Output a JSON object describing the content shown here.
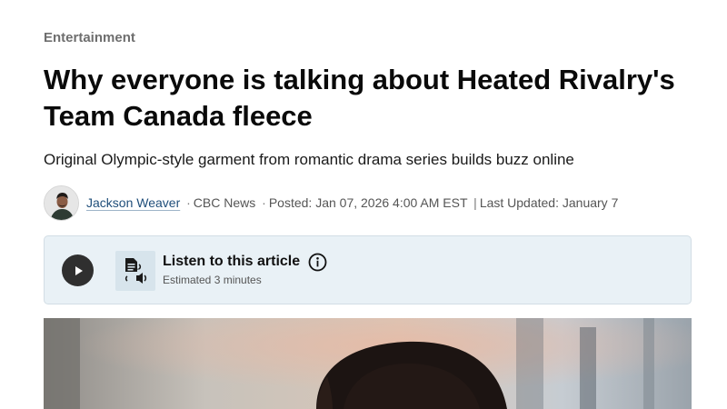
{
  "article": {
    "category": "Entertainment",
    "headline": "Why everyone is talking about Heated Rivalry's Team Canada fleece",
    "deck": "Original Olympic-style garment from romantic drama series builds buzz online"
  },
  "byline": {
    "author": "Jackson Weaver",
    "dot_sep": "·",
    "outlet": "CBC News",
    "posted": "Posted: Jan 07, 2026 4:00 AM EST",
    "pipe_sep": "|",
    "updated": "Last Updated: January 7"
  },
  "audio": {
    "title": "Listen to this article",
    "estimate": "Estimated 3 minutes",
    "icons": {
      "play": "play-icon",
      "document_audio": "document-audio-icon",
      "info": "info-icon"
    }
  },
  "colors": {
    "category": "#6e6e6e",
    "author_link": "#1f4e7a",
    "listen_bg": "#e9f1f6",
    "play_button": "#2f2f2f"
  }
}
